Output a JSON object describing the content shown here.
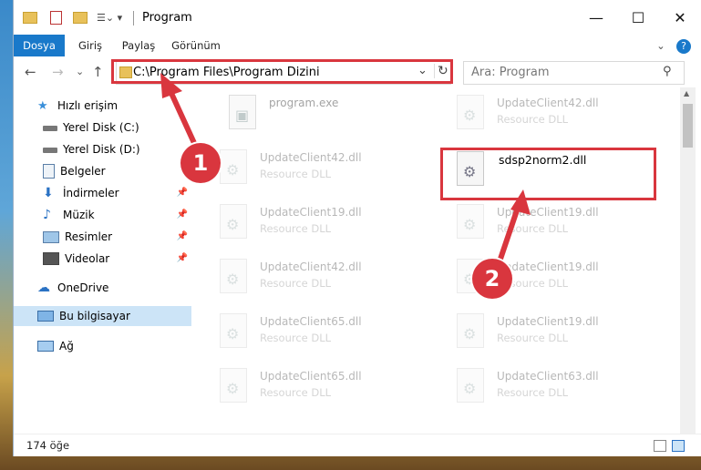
{
  "window": {
    "title": "Program",
    "minimize_glyph": "—",
    "maximize_glyph": "☐",
    "close_glyph": "✕"
  },
  "ribbon": {
    "tabs": [
      {
        "label": "Dosya"
      },
      {
        "label": "Giriş"
      },
      {
        "label": "Paylaş"
      },
      {
        "label": "Görünüm"
      }
    ],
    "expand_glyph": "⌄",
    "help_glyph": "?"
  },
  "address": {
    "path": "C:\\Program Files\\Program Dizini",
    "dropdown_glyph": "⌄",
    "refresh_glyph": "↻"
  },
  "search": {
    "placeholder": "Ara: Program",
    "icon": "search-icon"
  },
  "nav": {
    "back_glyph": "←",
    "forward_glyph": "→",
    "recent_glyph": "⌄",
    "up_glyph": "↑"
  },
  "sidebar": {
    "items": [
      {
        "label": "Hızlı erişim",
        "icon": "star-icon"
      },
      {
        "label": "Yerel Disk (C:)",
        "icon": "drive-icon"
      },
      {
        "label": "Yerel Disk (D:)",
        "icon": "drive-icon"
      },
      {
        "label": "Belgeler",
        "icon": "documents-icon"
      },
      {
        "label": "İndirmeler",
        "icon": "download-icon"
      },
      {
        "label": "Müzik",
        "icon": "music-icon"
      },
      {
        "label": "Resimler",
        "icon": "pictures-icon"
      },
      {
        "label": "Videolar",
        "icon": "videos-icon"
      },
      {
        "label": "OneDrive",
        "icon": "cloud-icon"
      },
      {
        "label": "Bu bilgisayar",
        "icon": "computer-icon"
      },
      {
        "label": "Ağ",
        "icon": "network-icon"
      }
    ]
  },
  "files": [
    {
      "name": "program.exe",
      "type": ""
    },
    {
      "name": "UpdateClient42.dll",
      "type": "Resource DLL"
    },
    {
      "name": "UpdateClient42.dll",
      "type": "Resource DLL"
    },
    {
      "name": "sdsp2norm2.dll",
      "type": ""
    },
    {
      "name": "UpdateClient19.dll",
      "type": "Resource DLL"
    },
    {
      "name": "UpdateClient19.dll",
      "type": "Resource DLL"
    },
    {
      "name": "UpdateClient42.dll",
      "type": "Resource DLL"
    },
    {
      "name": "UpdateClient19.dll",
      "type": "Resource DLL"
    },
    {
      "name": "UpdateClient65.dll",
      "type": "Resource DLL"
    },
    {
      "name": "UpdateClient19.dll",
      "type": "Resource DLL"
    },
    {
      "name": "UpdateClient65.dll",
      "type": "Resource DLL"
    },
    {
      "name": "UpdateClient63.dll",
      "type": "Resource DLL"
    }
  ],
  "status": {
    "item_count": "174 öğe"
  },
  "annotations": {
    "marker1": "1",
    "marker2": "2",
    "color": "#d9363e"
  }
}
